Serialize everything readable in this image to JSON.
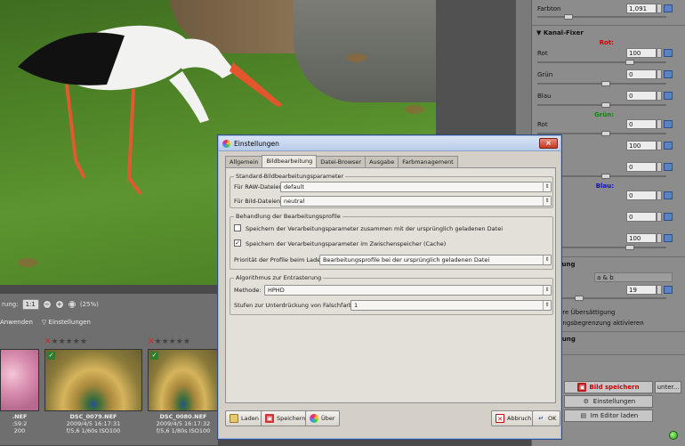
{
  "film_toolbar": {
    "zoom_label": "rung:",
    "zoom_value": "1:1",
    "zoom_percent": "(25%)",
    "apply_label": "Anwenden",
    "settings_label": "Einstellungen"
  },
  "thumbnails": [
    {
      "fname": ".NEF",
      "date": ":59:2",
      "info": "200",
      "kind": "blossom"
    },
    {
      "fname": "DSC_0079.NEF",
      "date": "2009/4/5 16:17:31",
      "info": "f/5,6 1/60s ISO100",
      "kind": "peacock"
    },
    {
      "fname": "DSC_0080.NEF",
      "date": "2009/4/5 16:17:32",
      "info": "f/5,6 1/80s ISO100",
      "kind": "peacock"
    }
  ],
  "right_panel": {
    "farbton_label": "Farbton",
    "farbton_value": "1,091",
    "kanal_title": "Kanal-Fixer",
    "rot_header": "Rot:",
    "gruen_header": "Grün:",
    "blau_header": "Blau:",
    "rows_rot": [
      {
        "label": "Rot",
        "value": "100"
      },
      {
        "label": "Grün",
        "value": "0"
      },
      {
        "label": "Blau",
        "value": "0"
      }
    ],
    "rows_gruen": [
      {
        "label": "Rot",
        "value": "0"
      },
      {
        "label": "",
        "value": "100"
      },
      {
        "label": "",
        "value": "0"
      }
    ],
    "rows_blau": [
      {
        "label": "",
        "value": "0"
      },
      {
        "label": "",
        "value": "0"
      },
      {
        "label": "",
        "value": "100"
      }
    ],
    "verstaerkung_title": "erstärkung",
    "kanal_label": "nal",
    "kanal_select": "a & b",
    "verstaerkung_value": "19",
    "check1": "ere Übersättigung",
    "check2": "ungsbegrenzung aktivieren",
    "verschiebung_title": "rschiebung",
    "save_button": "Bild speichern",
    "save_under": "unter...",
    "settings_button": "Einstellungen",
    "editor_button": "Im Editor laden"
  },
  "dialog": {
    "title": "Einstellungen",
    "tabs": [
      "Allgemein",
      "Bildbearbeitung",
      "Datei-Browser",
      "Ausgabe",
      "Farbmanagement"
    ],
    "active_tab": 1,
    "group1": {
      "title": "Standard-Bildbearbeitungsparameter",
      "raw_label": "Für RAW-Dateien:",
      "raw_value": "default",
      "img_label": "Für Bild-Dateien:",
      "img_value": "neutral"
    },
    "group2": {
      "title": "Behandlung der Bearbeitungsprofile",
      "check1_label": "Speichern der Verarbeitungsparameter zusammen mit der ursprünglich geladenen Datei",
      "check1_checked": false,
      "check2_label": "Speichern der Verarbeitungsparameter im Zwischenspeicher (Cache)",
      "check2_checked": true,
      "priority_label": "Priorität der Profile beim Laden:",
      "priority_value": "Bearbeitungsprofile bei der ursprünglich geladenen Datei"
    },
    "group3": {
      "title": "Algorithmus zur Entrasterung",
      "method_label": "Methode:",
      "method_value": "HPHD",
      "steps_label": "Stufen zur Unterdrückung von Falschfarben:",
      "steps_value": "1"
    },
    "footer": {
      "load": "Laden",
      "save": "Speichern",
      "about": "Über",
      "cancel": "Abbruch",
      "ok": "OK"
    }
  }
}
